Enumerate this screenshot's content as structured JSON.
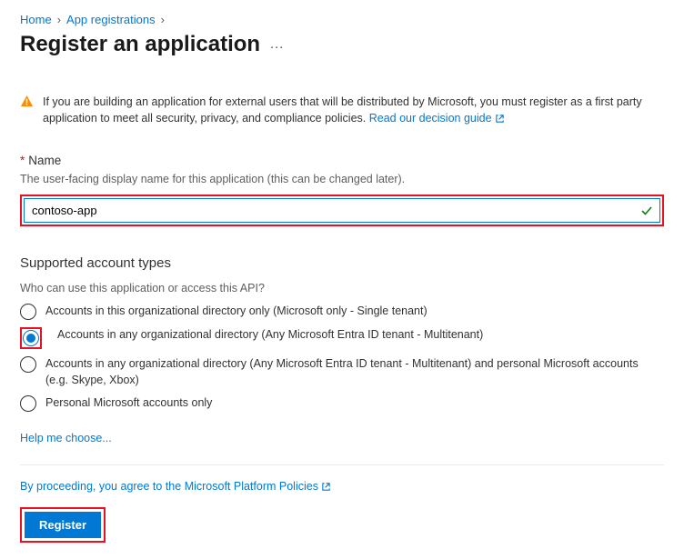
{
  "breadcrumb": {
    "home": "Home",
    "app_reg": "App registrations"
  },
  "page_title": "Register an application",
  "info": {
    "text": "If you are building an application for external users that will be distributed by Microsoft, you must register as a first party application to meet all security, privacy, and compliance policies. ",
    "link": "Read our decision guide"
  },
  "name_field": {
    "label": "Name",
    "desc": "The user-facing display name for this application (this can be changed later).",
    "value": "contoso-app"
  },
  "account_types": {
    "heading": "Supported account types",
    "question": "Who can use this application or access this API?",
    "options": [
      "Accounts in this organizational directory only (Microsoft only - Single tenant)",
      "Accounts in any organizational directory (Any Microsoft Entra ID tenant - Multitenant)",
      "Accounts in any organizational directory (Any Microsoft Entra ID tenant - Multitenant) and personal Microsoft accounts (e.g. Skype, Xbox)",
      "Personal Microsoft accounts only"
    ],
    "selected_index": 1
  },
  "help_link": "Help me choose...",
  "agree": {
    "prefix": "By proceeding, you agree to the ",
    "link": "Microsoft Platform Policies"
  },
  "register_label": "Register"
}
